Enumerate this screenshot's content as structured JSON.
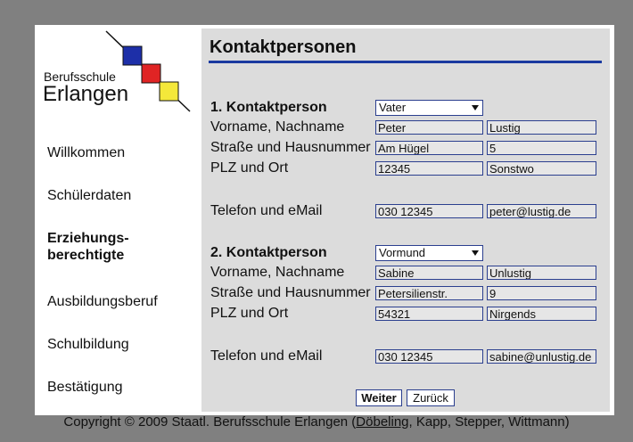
{
  "logo": {
    "line1": "Berufsschule",
    "line2": "Erlangen"
  },
  "sidebar": {
    "items": [
      {
        "label": "Willkommen"
      },
      {
        "label": "Schülerdaten"
      },
      {
        "label": "Erziehungs-berechtigte"
      },
      {
        "label": "Ausbildungsberuf"
      },
      {
        "label": "Schulbildung"
      },
      {
        "label": "Bestätigung"
      }
    ]
  },
  "main": {
    "title": "Kontaktpersonen",
    "labels": {
      "name": "Vorname, Nachname",
      "street": "Straße und Hausnummer",
      "city": "PLZ und Ort",
      "phone": "Telefon und eMail"
    },
    "contacts": [
      {
        "heading": "1. Kontaktperson",
        "relation": "Vater",
        "firstname": "Peter",
        "lastname": "Lustig",
        "street": "Am Hügel",
        "housenumber": "5",
        "zip": "12345",
        "city": "Sonstwo",
        "phone": "030 12345",
        "email": "peter@lustig.de"
      },
      {
        "heading": "2. Kontaktperson",
        "relation": "Vormund",
        "firstname": "Sabine",
        "lastname": "Unlustig",
        "street": "Petersilienstr.",
        "housenumber": "9",
        "zip": "54321",
        "city": "Nirgends",
        "phone": "030 12345",
        "email": "sabine@unlustig.de"
      }
    ],
    "buttons": {
      "next": "Weiter",
      "back": "Zurück"
    }
  },
  "footer": {
    "prefix": "Copyright © 2009 Staatl. Berufsschule Erlangen (",
    "link": "Döbeling",
    "suffix": ", Kapp, Stepper, Wittmann)"
  },
  "colors": {
    "accent": "#1a3aa0",
    "logo_blue": "#1d2fa8",
    "logo_red": "#e02424",
    "logo_yellow": "#f4e83a"
  }
}
